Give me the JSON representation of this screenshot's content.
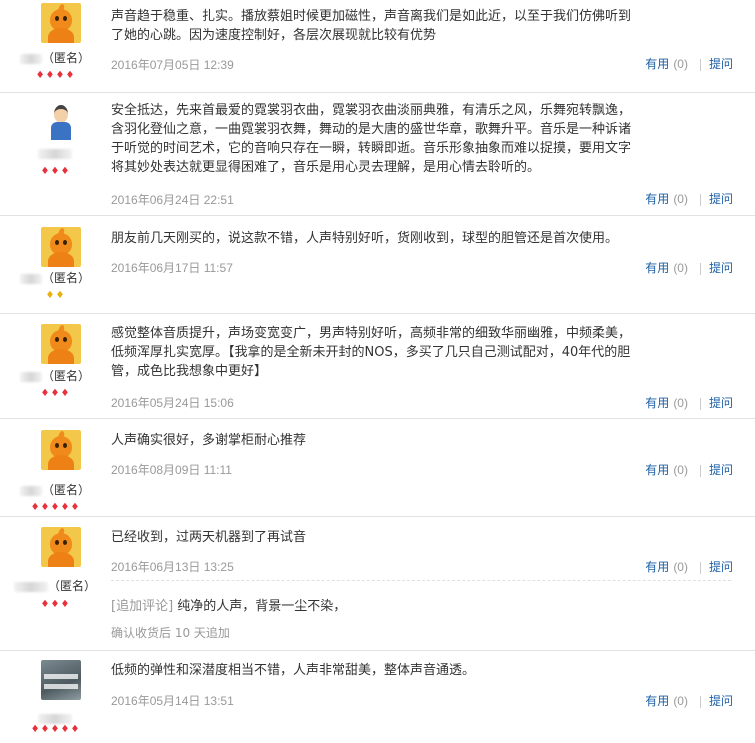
{
  "reviews": [
    {
      "text": "声音趋于稳重、扎实。播放蔡姐时候更加磁性，声音离我们是如此近，以至于我们仿佛听到了她的心跳。因为速度控制好，各层次展现就比较有优势",
      "date": "2016年07月05日 12:39",
      "user": "（匿名）",
      "avatar": "orange-mascot",
      "badge_count": 4,
      "badge_color": "#e8313b"
    },
    {
      "text": "安全抵达，先来首最爱的霓裳羽衣曲，霓裳羽衣曲淡丽典雅，有清乐之风，乐舞宛转飘逸，含羽化登仙之意，一曲霓裳羽衣舞，舞动的是大唐的盛世华章，歌舞升平。音乐是一种诉诸于听觉的时间艺术，它的音响只存在一瞬，转瞬即逝。音乐形象抽象而难以捉摸，要用文字将其妙处表达就更显得困难了，音乐是用心灵去理解，是用心情去聆听的。",
      "date": "2016年06月24日 22:51",
      "user": "",
      "avatar": "person",
      "badge_count": 3,
      "badge_color": "#e8313b"
    },
    {
      "text": "朋友前几天刚买的，说这款不错，人声特别好听，货刚收到，球型的胆管还是首次使用。",
      "date": "2016年06月17日 11:57",
      "user": "（匿名）",
      "avatar": "orange-mascot",
      "badge_count": 2,
      "badge_color": "#e8b10c"
    },
    {
      "text": "感觉整体音质提升，声场变宽变广，男声特别好听，高频非常的细致华丽幽雅，中频柔美，低频浑厚扎实宽厚。【我拿的是全新未开封的NOS，多买了几只自己测试配对，40年代的胆管，成色比我想象中更好】",
      "date": "2016年05月24日 15:06",
      "user": "（匿名）",
      "avatar": "orange-mascot",
      "badge_count": 3,
      "badge_color": "#e8313b"
    },
    {
      "text": "人声确实很好，多谢掌柜耐心推荐",
      "date": "2016年08月09日 11:11",
      "user": "（匿名）",
      "avatar": "orange-mascot",
      "badge_count": 5,
      "badge_color": "#e8313b"
    },
    {
      "text": "已经收到，过两天机器到了再试音",
      "date": "2016年06月13日 13:25",
      "user": "（匿名）",
      "avatar": "orange-mascot",
      "badge_count": 3,
      "badge_color": "#e8313b",
      "append_tag": "[追加评论]",
      "append_text": " 纯净的人声，背景一尘不染，",
      "append_note": "确认收货后 10 天追加"
    },
    {
      "text": "低频的弹性和深潜度相当不错，人声非常甜美，整体声音通透。",
      "date": "2016年05月14日 13:51",
      "user": "",
      "avatar": "poster",
      "poster_text": "不必說的事\n不必等的人",
      "badge_count": 5,
      "badge_color": "#e8313b"
    }
  ],
  "labels": {
    "useful": "有用",
    "count": "(0)",
    "ask": "提问"
  }
}
